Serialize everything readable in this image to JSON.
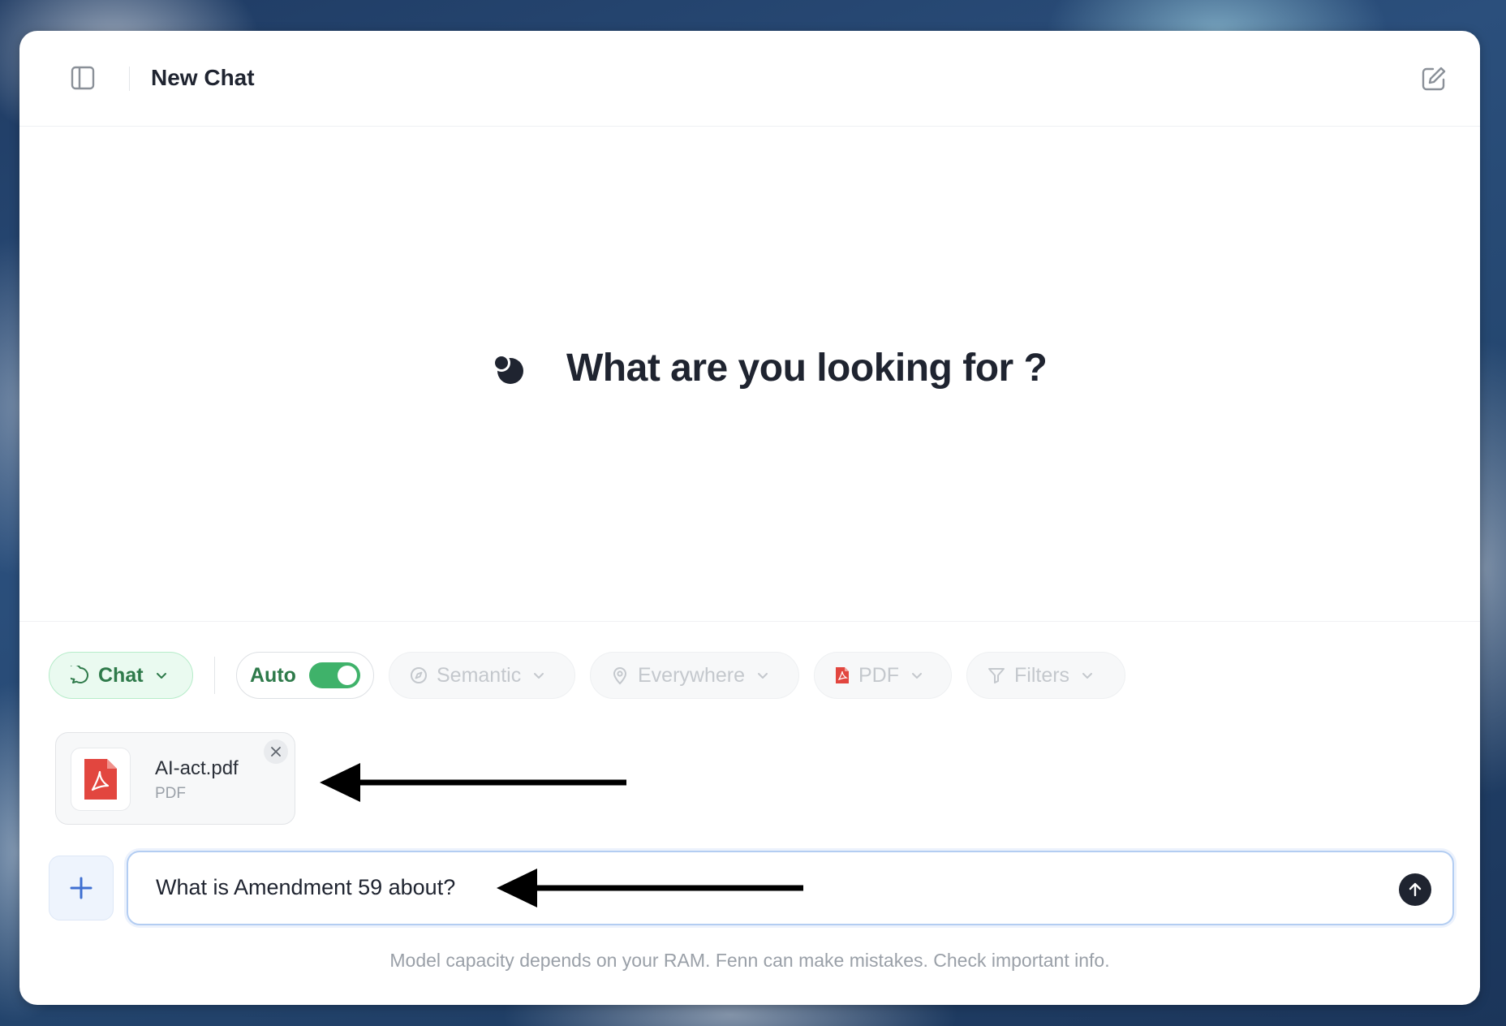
{
  "header": {
    "title": "New Chat"
  },
  "hero": {
    "title": "What are you looking for ?"
  },
  "toolbar": {
    "chat_label": "Chat",
    "auto_label": "Auto",
    "auto_enabled": true,
    "semantic_label": "Semantic",
    "everywhere_label": "Everywhere",
    "pdf_label": "PDF",
    "filters_label": "Filters"
  },
  "attachment": {
    "name": "AI-act.pdf",
    "type": "PDF"
  },
  "composer": {
    "value": "What is Amendment 59 about?"
  },
  "footer": {
    "note": "Model capacity depends on your RAM. Fenn can make mistakes. Check important info."
  },
  "colors": {
    "accent_green": "#3fb26a",
    "pdf_red": "#e2463f",
    "text_dark": "#1f2430"
  }
}
